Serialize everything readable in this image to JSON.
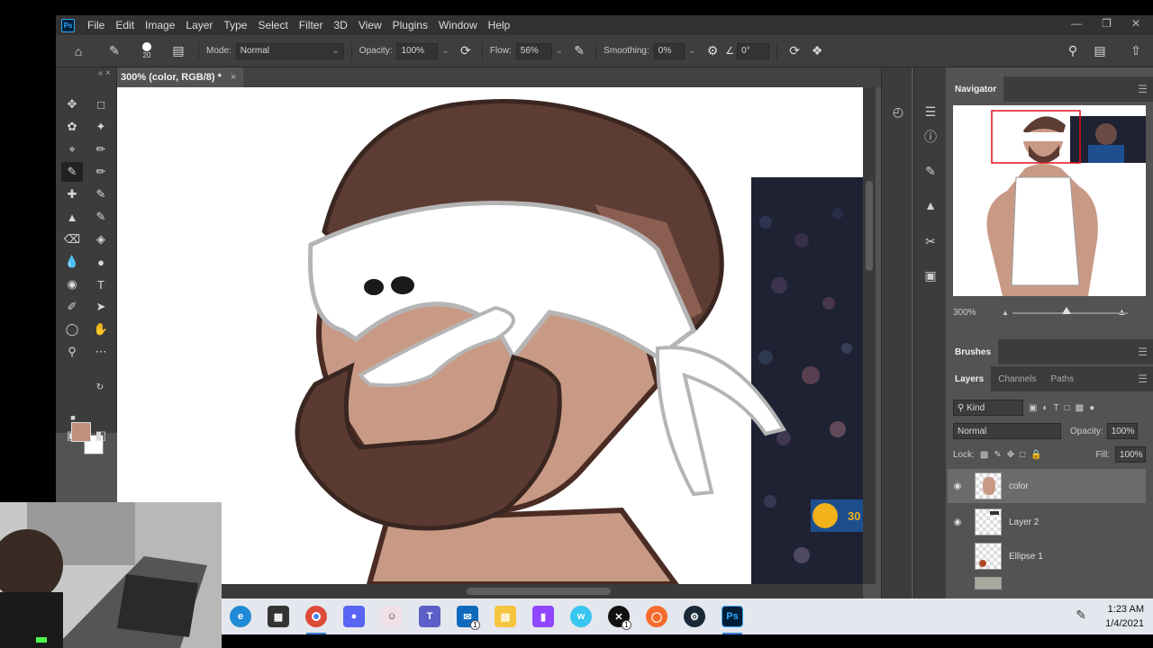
{
  "menu": {
    "logo": "Ps",
    "items": [
      "File",
      "Edit",
      "Image",
      "Layer",
      "Type",
      "Select",
      "Filter",
      "3D",
      "View",
      "Plugins",
      "Window",
      "Help"
    ],
    "window_controls": [
      "minimize-icon",
      "restore-icon",
      "close-icon"
    ]
  },
  "options": {
    "brush_size": "20",
    "mode_label": "Mode:",
    "mode_value": "Normal",
    "opacity_label": "Opacity:",
    "opacity_value": "100%",
    "flow_label": "Flow:",
    "flow_value": "56%",
    "smoothing_label": "Smoothing:",
    "smoothing_value": "0%",
    "angle_value": "0°"
  },
  "document": {
    "tab_title": "300% (color, RGB/8) *"
  },
  "toolbar": {
    "foreground_color": "#c28f7c",
    "background_color": "#ffffff"
  },
  "panels": {
    "navigator_title": "Navigator",
    "navigator_zoom": "300%",
    "brushes_title": "Brushes",
    "tabs": [
      "Layers",
      "Channels",
      "Paths"
    ],
    "filter_kind": "Kind",
    "blend_mode": "Normal",
    "opacity_label": "Opacity:",
    "opacity_value": "100%",
    "lock_label": "Lock:",
    "fill_label": "Fill:",
    "fill_value": "100%",
    "layers": [
      {
        "name": "color",
        "visible": true,
        "selected": true
      },
      {
        "name": "Layer 2",
        "visible": true,
        "selected": false
      },
      {
        "name": "Ellipse 1",
        "visible": false,
        "selected": false
      }
    ]
  },
  "taskbar": {
    "apps": [
      "edge",
      "store",
      "chrome",
      "discord",
      "app",
      "teams",
      "mail",
      "files",
      "twitch",
      "word",
      "xbox",
      "origin",
      "steam",
      "photoshop"
    ],
    "mail_badge": "1",
    "xbox_badge": "1",
    "time": "1:23 AM",
    "date": "1/4/2021"
  },
  "canvas": {
    "jersey_number": "30"
  }
}
